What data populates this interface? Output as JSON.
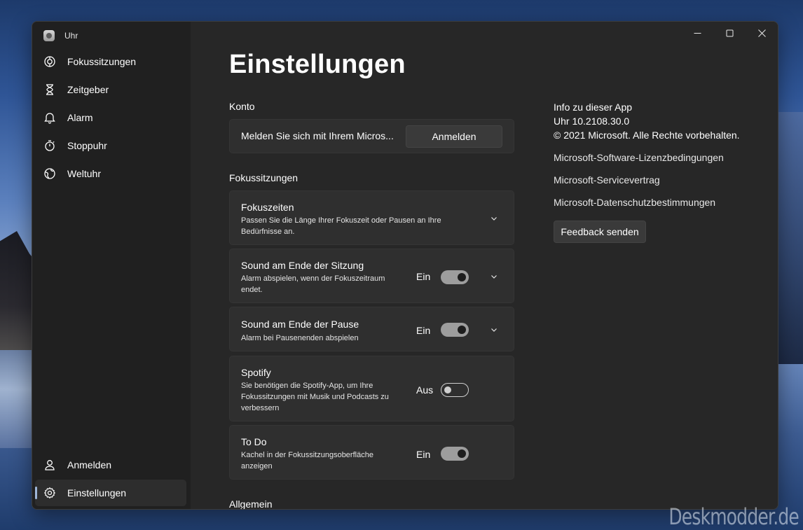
{
  "window": {
    "app_title": "Uhr"
  },
  "sidebar": {
    "items": [
      {
        "label": "Fokussitzungen",
        "icon": "focus-icon"
      },
      {
        "label": "Zeitgeber",
        "icon": "hourglass-icon"
      },
      {
        "label": "Alarm",
        "icon": "bell-icon"
      },
      {
        "label": "Stoppuhr",
        "icon": "stopwatch-icon"
      },
      {
        "label": "Weltuhr",
        "icon": "globe-icon"
      }
    ],
    "bottom_items": [
      {
        "label": "Anmelden",
        "icon": "person-icon"
      },
      {
        "label": "Einstellungen",
        "icon": "gear-icon",
        "active": true
      }
    ]
  },
  "page": {
    "title": "Einstellungen",
    "account_section": "Konto",
    "account_text": "Melden Sie sich mit Ihrem Micros...",
    "signin_button": "Anmelden",
    "focus_section": "Fokussitzungen",
    "general_section": "Allgemein",
    "cards": [
      {
        "title": "Fokuszeiten",
        "desc_lines": [
          "Passen Sie die Länge Ihrer Fokuszeit oder Pausen an Ihre",
          "Bedürfnisse an."
        ],
        "expandable": true
      },
      {
        "title": "Sound am Ende der Sitzung",
        "desc_lines": [
          "Alarm abspielen, wenn der Fokuszeitraum",
          "endet."
        ],
        "state": "Ein",
        "on": true,
        "expandable": true
      },
      {
        "title": "Sound am Ende der Pause",
        "desc_lines": [
          "Alarm bei Pausenenden abspielen"
        ],
        "state": "Ein",
        "on": true,
        "expandable": true
      },
      {
        "title": "Spotify",
        "desc_lines": [
          "Sie benötigen die Spotify-App, um Ihre",
          "Fokussitzungen mit Musik und Podcasts zu",
          "verbessern"
        ],
        "state": "Aus",
        "on": false,
        "expandable": false
      },
      {
        "title": "To Do",
        "desc_lines": [
          "Kachel in der Fokussitzungsoberfläche",
          "anzeigen"
        ],
        "state": "Ein",
        "on": true,
        "expandable": false
      }
    ]
  },
  "info": {
    "heading": "Info zu dieser App",
    "version": "Uhr 10.2108.30.0",
    "copyright": "© 2021 Microsoft. Alle Rechte vorbehalten.",
    "links": [
      "Microsoft-Software-Lizenzbedingungen",
      "Microsoft-Servicevertrag",
      "Microsoft-Datenschutzbestimmungen"
    ],
    "feedback_button": "Feedback senden"
  },
  "watermark": "Deskmodder.de",
  "colors": {
    "toggle_on": "#9d9d9d",
    "accent_indicator": "#9fb7d9",
    "window_bg": "#272727",
    "sidebar_bg": "#202020"
  }
}
